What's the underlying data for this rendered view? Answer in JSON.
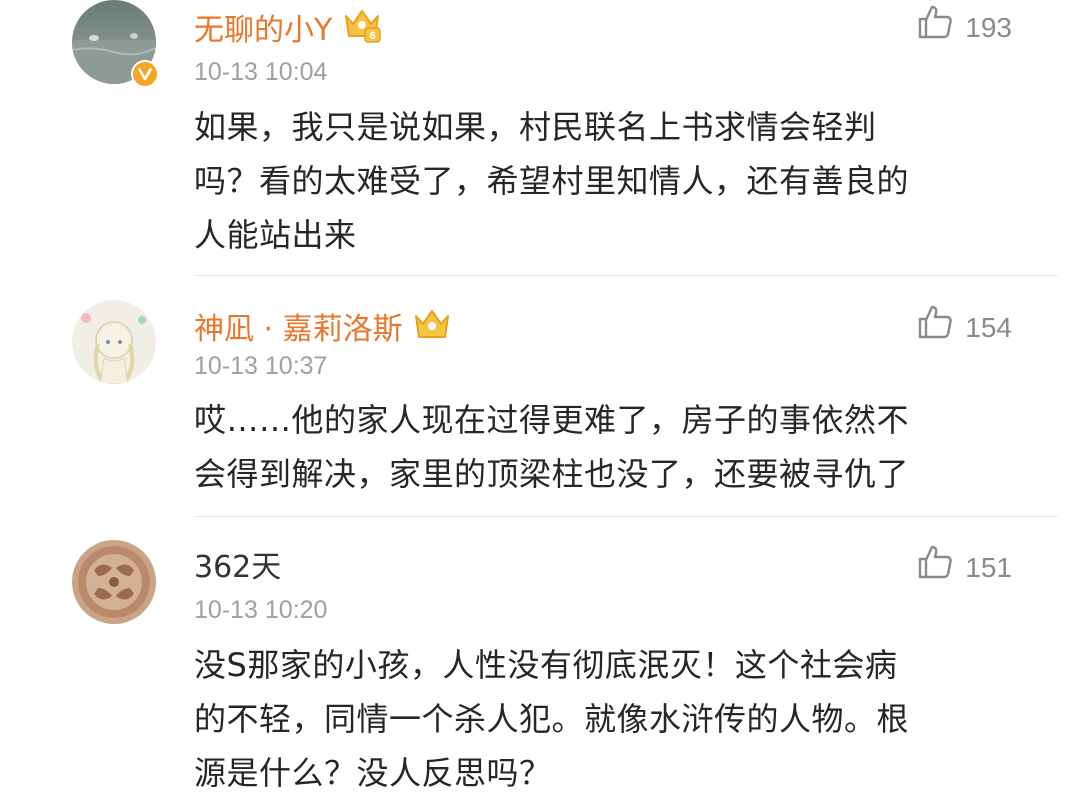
{
  "comments": [
    {
      "username": "无聊的小Y",
      "time": "10-13 10:04",
      "likes": "193",
      "text_lines": [
        "如果，我只是说如果，村民联名上书求情会轻判",
        "吗？看的太难受了，希望村里知情人，还有善良的",
        "人能站出来"
      ],
      "vip_badge": "crown-6-icon",
      "verified_badge": "verified-v-icon"
    },
    {
      "username": "神凪 · 嘉莉洛斯",
      "time": "10-13 10:37",
      "likes": "154",
      "text_lines": [
        "哎……他的家人现在过得更难了，房子的事依然不",
        "会得到解决，家里的顶梁柱也没了，还要被寻仇了"
      ],
      "vip_badge": "crown-icon"
    },
    {
      "username": "362天",
      "time": "10-13 10:20",
      "likes": "151",
      "text_lines": [
        "没S那家的小孩，人性没有彻底泯灭！这个社会病",
        "的不轻，同情一个杀人犯。就像水浒传的人物。根",
        "源是什么？没人反思吗？"
      ]
    }
  ],
  "colors": {
    "vip_name": "#e8772a",
    "plain_name": "#333333",
    "timestamp": "#a0a0a0",
    "like_count": "#8a8a8a",
    "body_text": "#262626",
    "verified_badge": "#f5a623"
  }
}
